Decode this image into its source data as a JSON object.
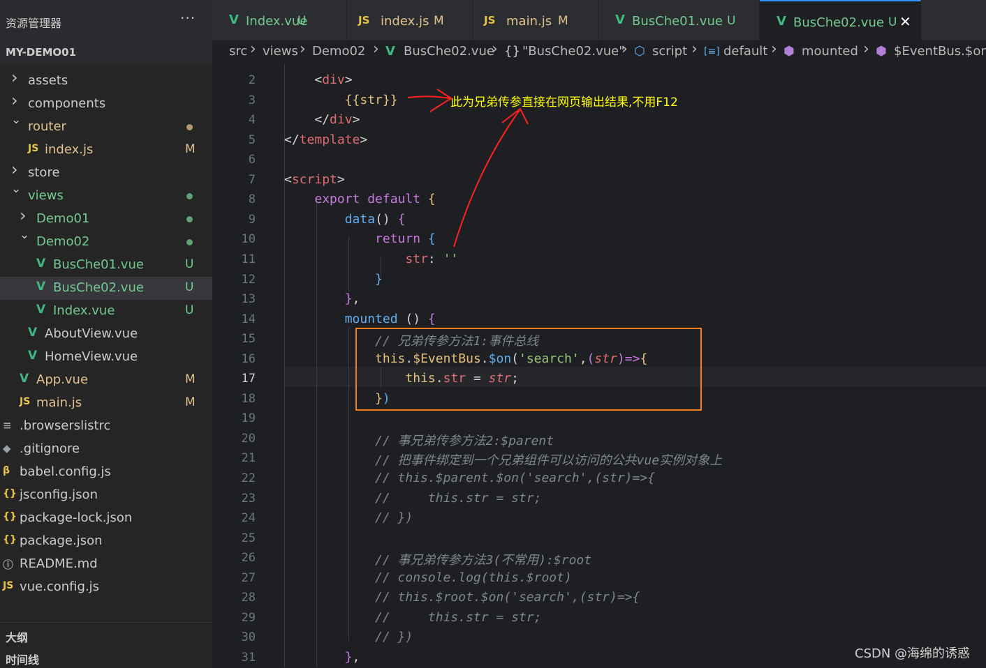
{
  "explorer": {
    "title": "资源管理器",
    "more_label": "···",
    "project": "MY-DEMO01",
    "items": [
      {
        "label": "assets",
        "kind": "folder",
        "state": "collapsed",
        "depth": 1,
        "status": "",
        "color": "#cccccc"
      },
      {
        "label": "components",
        "kind": "folder",
        "state": "collapsed",
        "depth": 1,
        "status": "",
        "color": "#cccccc"
      },
      {
        "label": "router",
        "kind": "folder",
        "state": "expanded",
        "depth": 1,
        "status": "dot",
        "color": "#e2c08d"
      },
      {
        "label": "index.js",
        "kind": "js",
        "state": "",
        "depth": 2,
        "status": "M",
        "color": "#e2c08d"
      },
      {
        "label": "store",
        "kind": "folder",
        "state": "collapsed",
        "depth": 1,
        "status": "",
        "color": "#cccccc"
      },
      {
        "label": "views",
        "kind": "folder",
        "state": "expanded",
        "depth": 1,
        "status": "dot",
        "color": "#73c991"
      },
      {
        "label": "Demo01",
        "kind": "folder",
        "state": "collapsed",
        "depth": 2,
        "status": "dot",
        "color": "#73c991"
      },
      {
        "label": "Demo02",
        "kind": "folder",
        "state": "expanded",
        "depth": 2,
        "status": "dot",
        "color": "#73c991"
      },
      {
        "label": "BusChe01.vue",
        "kind": "vue",
        "state": "",
        "depth": 3,
        "status": "U",
        "color": "#73c991"
      },
      {
        "label": "BusChe02.vue",
        "kind": "vue",
        "state": "",
        "depth": 3,
        "status": "U",
        "color": "#73c991",
        "selected": true
      },
      {
        "label": "Index.vue",
        "kind": "vue",
        "state": "",
        "depth": 3,
        "status": "U",
        "color": "#73c991"
      },
      {
        "label": "AboutView.vue",
        "kind": "vue",
        "state": "",
        "depth": 2,
        "status": "",
        "color": "#cccccc"
      },
      {
        "label": "HomeView.vue",
        "kind": "vue",
        "state": "",
        "depth": 2,
        "status": "",
        "color": "#cccccc"
      },
      {
        "label": "App.vue",
        "kind": "vue",
        "state": "",
        "depth": 1,
        "status": "M",
        "color": "#e2c08d"
      },
      {
        "label": "main.js",
        "kind": "js",
        "state": "",
        "depth": 1,
        "status": "M",
        "color": "#e2c08d"
      },
      {
        "label": ".browserslistrc",
        "kind": "list",
        "state": "",
        "depth": 0,
        "status": "",
        "color": "#cccccc"
      },
      {
        "label": ".gitignore",
        "kind": "git",
        "state": "",
        "depth": 0,
        "status": "",
        "color": "#cccccc"
      },
      {
        "label": "babel.config.js",
        "kind": "babel",
        "state": "",
        "depth": 0,
        "status": "",
        "color": "#cccccc"
      },
      {
        "label": "jsconfig.json",
        "kind": "json",
        "state": "",
        "depth": 0,
        "status": "",
        "color": "#cccccc"
      },
      {
        "label": "package-lock.json",
        "kind": "json",
        "state": "",
        "depth": 0,
        "status": "",
        "color": "#cccccc"
      },
      {
        "label": "package.json",
        "kind": "json",
        "state": "",
        "depth": 0,
        "status": "",
        "color": "#cccccc"
      },
      {
        "label": "README.md",
        "kind": "info",
        "state": "",
        "depth": 0,
        "status": "",
        "color": "#cccccc"
      },
      {
        "label": "vue.config.js",
        "kind": "js",
        "state": "",
        "depth": 0,
        "status": "",
        "color": "#cccccc"
      }
    ],
    "outline_label": "大纲",
    "timeline_label": "时间线"
  },
  "tabs": [
    {
      "label": "Index.vue",
      "icon": "vue",
      "status": "U",
      "active": false
    },
    {
      "label": "index.js",
      "icon": "js",
      "status": "M",
      "active": false
    },
    {
      "label": "main.js",
      "icon": "js",
      "status": "M",
      "active": false
    },
    {
      "label": "BusChe01.vue",
      "icon": "vue",
      "status": "U",
      "active": false
    },
    {
      "label": "BusChe02.vue",
      "icon": "vue",
      "status": "U",
      "active": true
    }
  ],
  "icons": {
    "vue": "V",
    "js": "JS",
    "close": "✕",
    "chevron_right": "›",
    "chevron_down": "⌄"
  },
  "breadcrumb": [
    {
      "label": "src",
      "icon": ""
    },
    {
      "label": "views",
      "icon": ""
    },
    {
      "label": "Demo02",
      "icon": ""
    },
    {
      "label": "BusChe02.vue",
      "icon": "vue"
    },
    {
      "label": "\"BusChe02.vue\"",
      "icon": "braces"
    },
    {
      "label": "script",
      "icon": "cube"
    },
    {
      "label": "default",
      "icon": "field"
    },
    {
      "label": "mounted",
      "icon": "method"
    },
    {
      "label": "$EventBus.$on(",
      "icon": "method"
    }
  ],
  "editor": {
    "current_line": 17,
    "annotation": "此为兄弟传参直接在网页输出结果,不用F12",
    "lines": [
      {
        "n": 2,
        "tokens": [
          [
            "    ",
            "plain"
          ],
          [
            "<",
            "plain"
          ],
          [
            "div",
            "tag"
          ],
          [
            ">",
            "plain"
          ]
        ]
      },
      {
        "n": 3,
        "tokens": [
          [
            "        ",
            "plain"
          ],
          [
            "{{str}}",
            "mus"
          ]
        ]
      },
      {
        "n": 4,
        "tokens": [
          [
            "    ",
            "plain"
          ],
          [
            "</",
            "plain"
          ],
          [
            "div",
            "tag"
          ],
          [
            ">",
            "plain"
          ]
        ]
      },
      {
        "n": 5,
        "tokens": [
          [
            "</",
            "plain"
          ],
          [
            "template",
            "tag"
          ],
          [
            ">",
            "plain"
          ]
        ]
      },
      {
        "n": 6,
        "tokens": []
      },
      {
        "n": 7,
        "tokens": [
          [
            "<",
            "plain"
          ],
          [
            "script",
            "tag"
          ],
          [
            ">",
            "plain"
          ]
        ]
      },
      {
        "n": 8,
        "tokens": [
          [
            "    ",
            "plain"
          ],
          [
            "export default ",
            "kw"
          ],
          [
            "{",
            "prop"
          ]
        ]
      },
      {
        "n": 9,
        "tokens": [
          [
            "        ",
            "plain"
          ],
          [
            "data",
            "fn"
          ],
          [
            "() ",
            "plain"
          ],
          [
            "{",
            "kw"
          ]
        ]
      },
      {
        "n": 10,
        "tokens": [
          [
            "            ",
            "plain"
          ],
          [
            "return ",
            "kw"
          ],
          [
            "{",
            "fn"
          ]
        ]
      },
      {
        "n": 11,
        "tokens": [
          [
            "                ",
            "plain"
          ],
          [
            "str",
            "tag"
          ],
          [
            ": ",
            "plain"
          ],
          [
            "''",
            "strc"
          ]
        ]
      },
      {
        "n": 12,
        "tokens": [
          [
            "            ",
            "plain"
          ],
          [
            "}",
            "fn"
          ]
        ]
      },
      {
        "n": 13,
        "tokens": [
          [
            "        ",
            "plain"
          ],
          [
            "}",
            "kw"
          ],
          [
            ",",
            "plain"
          ]
        ]
      },
      {
        "n": 14,
        "tokens": [
          [
            "        ",
            "plain"
          ],
          [
            "mounted ",
            "fn"
          ],
          [
            "() ",
            "plain"
          ],
          [
            "{",
            "kw"
          ]
        ]
      },
      {
        "n": 15,
        "tokens": [
          [
            "            ",
            "plain"
          ],
          [
            "// 兄弟传参方法1:事件总线",
            "cmt"
          ]
        ]
      },
      {
        "n": 16,
        "tokens": [
          [
            "            ",
            "plain"
          ],
          [
            "this",
            "prop"
          ],
          [
            ".",
            "plain"
          ],
          [
            "$EventBus",
            "prop"
          ],
          [
            ".",
            "plain"
          ],
          [
            "$on",
            "fn"
          ],
          [
            "(",
            "plain"
          ],
          [
            "'search'",
            "strc"
          ],
          [
            ",",
            "plain"
          ],
          [
            "(",
            "kw"
          ],
          [
            "str",
            "param"
          ],
          [
            ")",
            "kw"
          ],
          [
            "=>",
            "kw"
          ],
          [
            "{",
            "prop"
          ]
        ]
      },
      {
        "n": 17,
        "tokens": [
          [
            "                ",
            "plain"
          ],
          [
            "this",
            "prop"
          ],
          [
            ".",
            "plain"
          ],
          [
            "str",
            "tag"
          ],
          [
            " = ",
            "plain"
          ],
          [
            "str",
            "param"
          ],
          [
            ";",
            "plain"
          ]
        ]
      },
      {
        "n": 18,
        "tokens": [
          [
            "            ",
            "plain"
          ],
          [
            "}",
            "prop"
          ],
          [
            ")",
            "fn"
          ]
        ]
      },
      {
        "n": 19,
        "tokens": []
      },
      {
        "n": 20,
        "tokens": [
          [
            "            ",
            "plain"
          ],
          [
            "// 事兄弟传参方法2:$parent",
            "cmt"
          ]
        ]
      },
      {
        "n": 21,
        "tokens": [
          [
            "            ",
            "plain"
          ],
          [
            "// 把事件绑定到一个兄弟组件可以访问的公共vue实例对象上",
            "cmt"
          ]
        ]
      },
      {
        "n": 22,
        "tokens": [
          [
            "            ",
            "plain"
          ],
          [
            "// this.$parent.$on('search',(str)=>{",
            "cmt"
          ]
        ]
      },
      {
        "n": 23,
        "tokens": [
          [
            "            ",
            "plain"
          ],
          [
            "//     this.str = str;",
            "cmt"
          ]
        ]
      },
      {
        "n": 24,
        "tokens": [
          [
            "            ",
            "plain"
          ],
          [
            "// })",
            "cmt"
          ]
        ]
      },
      {
        "n": 25,
        "tokens": []
      },
      {
        "n": 26,
        "tokens": [
          [
            "            ",
            "plain"
          ],
          [
            "// 事兄弟传参方法3(不常用):$root",
            "cmt"
          ]
        ]
      },
      {
        "n": 27,
        "tokens": [
          [
            "            ",
            "plain"
          ],
          [
            "// console.log(this.$root)",
            "cmt"
          ]
        ]
      },
      {
        "n": 28,
        "tokens": [
          [
            "            ",
            "plain"
          ],
          [
            "// this.$root.$on('search',(str)=>{",
            "cmt"
          ]
        ]
      },
      {
        "n": 29,
        "tokens": [
          [
            "            ",
            "plain"
          ],
          [
            "//     this.str = str;",
            "cmt"
          ]
        ]
      },
      {
        "n": 30,
        "tokens": [
          [
            "            ",
            "plain"
          ],
          [
            "// })",
            "cmt"
          ]
        ]
      },
      {
        "n": 31,
        "tokens": [
          [
            "        ",
            "plain"
          ],
          [
            "}",
            "kw"
          ],
          [
            ",",
            "plain"
          ]
        ]
      }
    ]
  },
  "watermark": "CSDN @海绵的诱惑",
  "colors": {
    "accent": "#3794ff",
    "vue": "#41b883",
    "js": "#e8c547",
    "annotation": "#ffff00",
    "box": "#f07f20",
    "arrow": "#ff2020"
  }
}
